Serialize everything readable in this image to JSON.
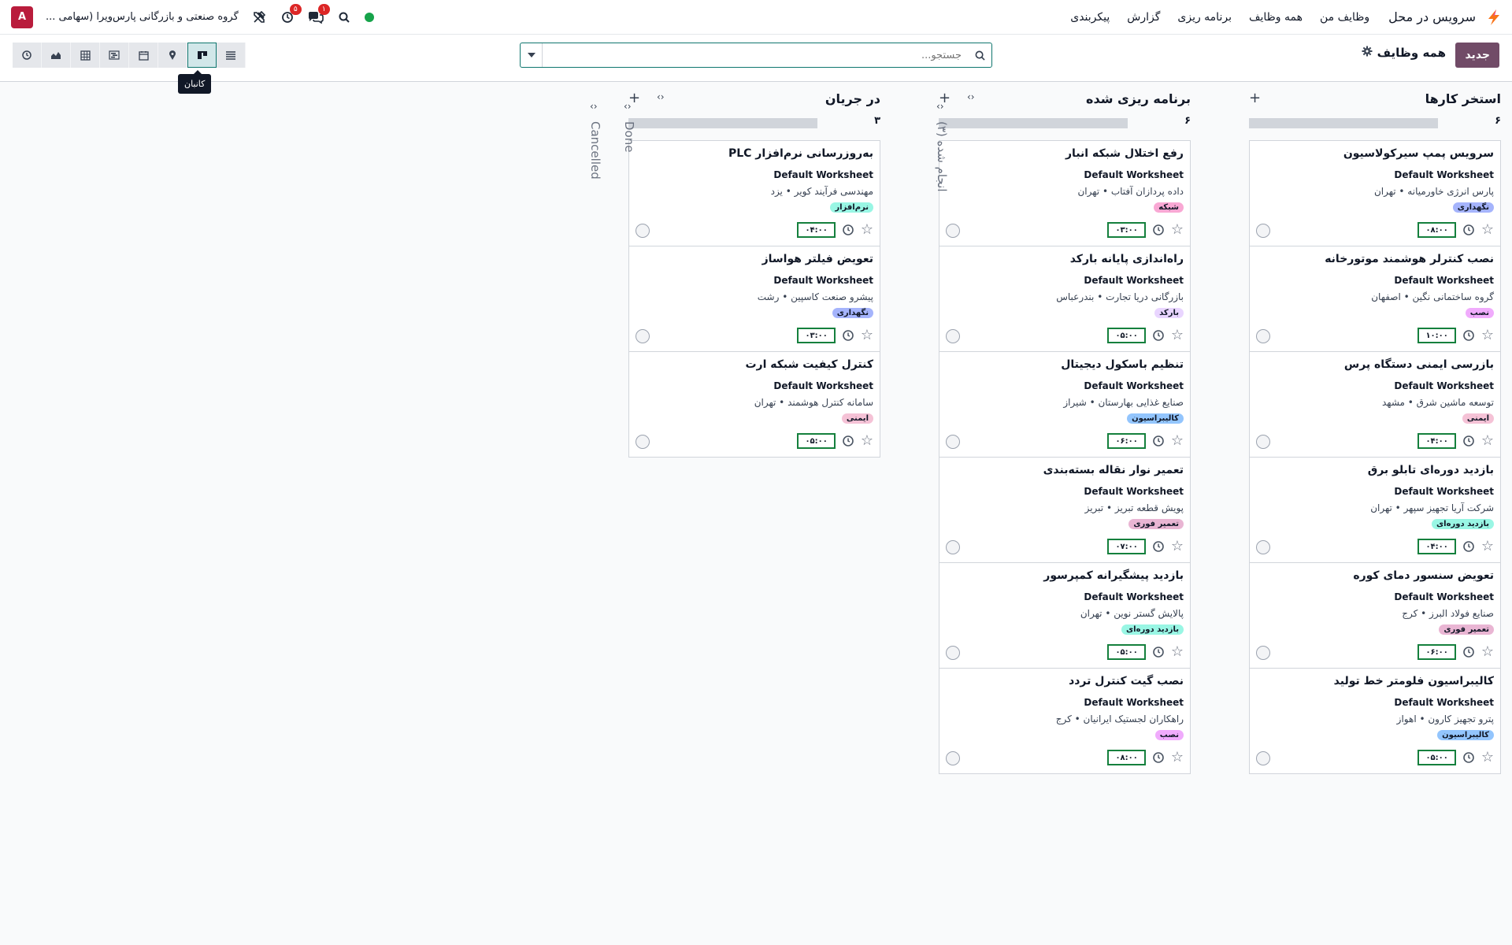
{
  "navbar": {
    "app_name": "سرویس در محل",
    "menu": [
      "وظایف من",
      "همه وظایف",
      "برنامه ریزی",
      "گزارش",
      "پیکربندی"
    ],
    "company": "گروه صنعتی و بازرگانی پارس‌ویرا (سهامی ...",
    "avatar_initial": "A",
    "activity_badge": "۵",
    "chat_badge": "۱"
  },
  "control": {
    "new_button": "جدید",
    "breadcrumb": "همه وظایف",
    "search_placeholder": "جستجو...",
    "tooltip": "کانبان"
  },
  "columns": [
    {
      "title": "استخر کارها",
      "count": "۶",
      "cards": [
        {
          "title": "سرویس پمپ سیرکولاسیون",
          "sheet": "Default Worksheet",
          "customer": "پارس انرژی خاورمیانه • تهران",
          "tag": "نگهداری",
          "tag_color": "#a5b4fc",
          "time": "۰۸:۰۰"
        },
        {
          "title": "نصب کنترلر هوشمند موتورخانه",
          "sheet": "Default Worksheet",
          "customer": "گروه ساختمانی نگین • اصفهان",
          "tag": "نصب",
          "tag_color": "#f0abfc",
          "time": "۱۰:۰۰"
        },
        {
          "title": "بازرسی ایمنی دستگاه پرس",
          "sheet": "Default Worksheet",
          "customer": "توسعه ماشین شرق • مشهد",
          "tag": "ایمنی",
          "tag_color": "#f5c2d6",
          "time": "۰۴:۰۰"
        },
        {
          "title": "بازدید دوره‌ای تابلو برق",
          "sheet": "Default Worksheet",
          "customer": "شرکت آریا تجهیز سپهر • تهران",
          "tag": "بازدید دوره‌ای",
          "tag_color": "#99f6e4",
          "time": "۰۴:۰۰"
        },
        {
          "title": "تعویض سنسور دمای کوره",
          "sheet": "Default Worksheet",
          "customer": "صنایع فولاد البرز • کرج",
          "tag": "تعمیر فوری",
          "tag_color": "#e9b5d3",
          "time": "۰۶:۰۰"
        },
        {
          "title": "کالیبراسیون فلومتر خط تولید",
          "sheet": "Default Worksheet",
          "customer": "پترو تجهیز کارون • اهواز",
          "tag": "کالیبراسیون",
          "tag_color": "#93c5fd",
          "time": "۰۵:۰۰"
        }
      ]
    },
    {
      "title": "برنامه ریزی شده",
      "count": "۶",
      "cards": [
        {
          "title": "رفع اختلال شبکه انبار",
          "sheet": "Default Worksheet",
          "customer": "داده پردازان آفتاب • تهران",
          "tag": "شبکه",
          "tag_color": "#f9a8d4",
          "time": "۰۳:۰۰"
        },
        {
          "title": "راه‌اندازی پایانه بارکد",
          "sheet": "Default Worksheet",
          "customer": "بازرگانی دریا تجارت • بندرعباس",
          "tag": "بارکد",
          "tag_color": "#e9d5ff",
          "time": "۰۵:۰۰"
        },
        {
          "title": "تنظیم باسکول دیجیتال",
          "sheet": "Default Worksheet",
          "customer": "صنایع غذایی بهارستان • شیراز",
          "tag": "کالیبراسیون",
          "tag_color": "#93c5fd",
          "time": "۰۶:۰۰"
        },
        {
          "title": "تعمیر نوار نقاله بسته‌بندی",
          "sheet": "Default Worksheet",
          "customer": "پویش قطعه تبریز • تبریز",
          "tag": "تعمیر فوری",
          "tag_color": "#e9b5d3",
          "time": "۰۷:۰۰"
        },
        {
          "title": "بازدید پیشگیرانه کمپرسور",
          "sheet": "Default Worksheet",
          "customer": "پالایش گستر نوین • تهران",
          "tag": "بازدید دوره‌ای",
          "tag_color": "#99f6e4",
          "time": "۰۵:۰۰"
        },
        {
          "title": "نصب گیت کنترل تردد",
          "sheet": "Default Worksheet",
          "customer": "راهکاران لجستیک ایرانیان • کرج",
          "tag": "نصب",
          "tag_color": "#f0abfc",
          "time": "۰۸:۰۰"
        }
      ]
    },
    {
      "title": "در جریان",
      "count": "۳",
      "cards": [
        {
          "title": "به‌روزرسانی نرم‌افزار PLC",
          "sheet": "Default Worksheet",
          "customer": "مهندسی فرآیند کویر • یزد",
          "tag": "نرم‌افزار",
          "tag_color": "#99f6e4",
          "time": "۰۴:۰۰"
        },
        {
          "title": "تعویض فیلتر هواساز",
          "sheet": "Default Worksheet",
          "customer": "پیشرو صنعت کاسپین • رشت",
          "tag": "نگهداری",
          "tag_color": "#a5b4fc",
          "time": "۰۳:۰۰"
        },
        {
          "title": "کنترل کیفیت شبکه ارت",
          "sheet": "Default Worksheet",
          "customer": "سامانه کنترل هوشمند • تهران",
          "tag": "ایمنی",
          "tag_color": "#f5c2d6",
          "time": "۰۵:۰۰"
        }
      ]
    }
  ],
  "folded": {
    "done_fa": "انجام شده (۳)",
    "done_en": "Done",
    "cancelled": "Cancelled"
  }
}
